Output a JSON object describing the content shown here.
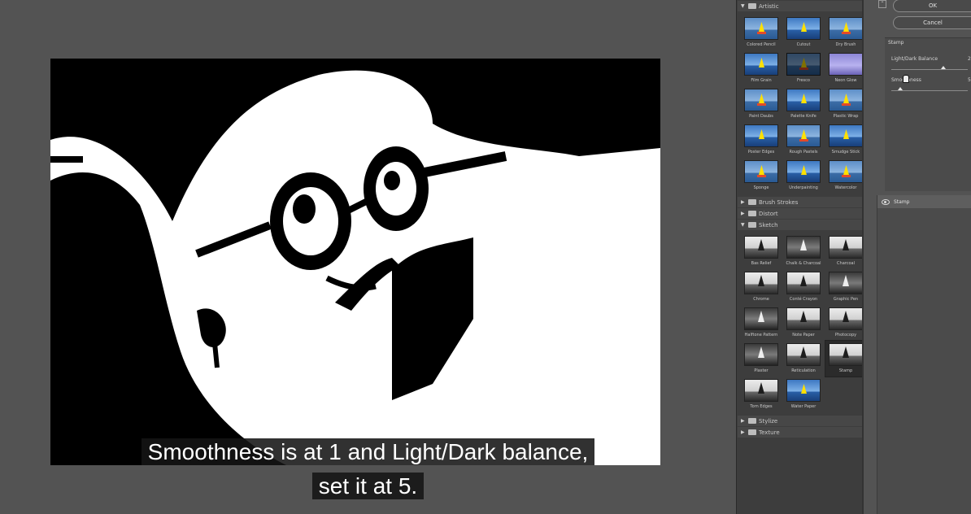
{
  "caption": {
    "line1": "Smoothness is at 1 and Light/Dark balance,",
    "line2": "set it at 5."
  },
  "gallery": {
    "categories": [
      {
        "name": "Artistic",
        "expanded": true,
        "filters": [
          "Colored Pencil",
          "Cutout",
          "Dry Brush",
          "Film Grain",
          "Fresco",
          "Neon Glow",
          "Paint Daubs",
          "Palette Knife",
          "Plastic Wrap",
          "Poster Edges",
          "Rough Pastels",
          "Smudge Stick",
          "Sponge",
          "Underpainting",
          "Watercolor"
        ]
      },
      {
        "name": "Brush Strokes",
        "expanded": false
      },
      {
        "name": "Distort",
        "expanded": false
      },
      {
        "name": "Sketch",
        "expanded": true,
        "filters": [
          "Bas Relief",
          "Chalk & Charcoal",
          "Charcoal",
          "Chrome",
          "Conté Crayon",
          "Graphic Pen",
          "Halftone Pattern",
          "Note Paper",
          "Photocopy",
          "Plaster",
          "Reticulation",
          "Stamp",
          "Torn Edges",
          "Water Paper"
        ],
        "selected": "Stamp"
      },
      {
        "name": "Stylize",
        "expanded": false
      },
      {
        "name": "Texture",
        "expanded": false
      }
    ]
  },
  "buttons": {
    "ok": "OK",
    "cancel": "Cancel"
  },
  "settings": {
    "filter_name": "Stamp",
    "params": [
      {
        "label": "Light/Dark Balance",
        "value": "2",
        "level": 0.68
      },
      {
        "label": "Smoothness",
        "value": "5",
        "level": 0.12
      }
    ]
  },
  "layers": [
    {
      "name": "Stamp"
    }
  ],
  "icons": {
    "eye": "eye-icon",
    "folder": "folder-icon",
    "collapse": "collapse-icon"
  }
}
